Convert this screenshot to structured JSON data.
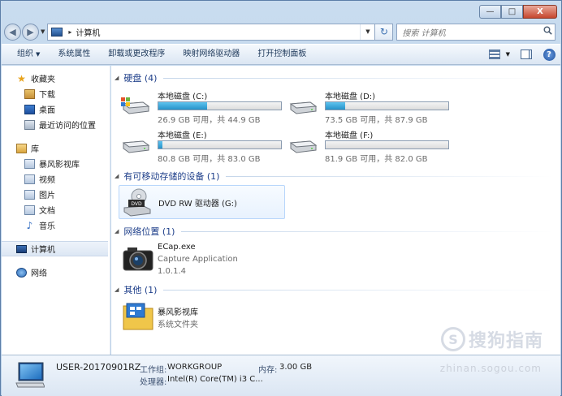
{
  "window": {
    "min": "—",
    "max": "□",
    "close": "X"
  },
  "nav": {
    "back": "◀",
    "forward": "▶",
    "history": "▼",
    "address": "计算机",
    "address_sep": "▸",
    "dropdown": "▼",
    "refresh": "↻"
  },
  "search": {
    "placeholder": "搜索 计算机",
    "icon": "search-icon"
  },
  "toolbar": {
    "organize": "组织",
    "system_properties": "系统属性",
    "uninstall": "卸载或更改程序",
    "map_drive": "映射网络驱动器",
    "control_panel": "打开控制面板",
    "view_arrow": "▼",
    "help": "?"
  },
  "sidebar": {
    "favorites": "收藏夹",
    "downloads": "下载",
    "desktop": "桌面",
    "recent": "最近访问的位置",
    "libraries": "库",
    "storm": "暴风影视库",
    "videos": "视频",
    "pictures": "图片",
    "documents": "文档",
    "music": "音乐",
    "computer": "计算机",
    "network": "网络"
  },
  "sections": {
    "hdd": "硬盘 (4)",
    "removable": "有可移动存储的设备 (1)",
    "network": "网络位置 (1)",
    "other": "其他 (1)"
  },
  "drives": [
    {
      "name": "本地磁盘 (C:)",
      "free": "26.9 GB 可用，共 44.9 GB",
      "used_fraction": 0.4
    },
    {
      "name": "本地磁盘 (D:)",
      "free": "73.5 GB 可用，共 87.9 GB",
      "used_fraction": 0.16
    },
    {
      "name": "本地磁盘 (E:)",
      "free": "80.8 GB 可用，共 83.0 GB",
      "used_fraction": 0.03
    },
    {
      "name": "本地磁盘 (F:)",
      "free": "81.9 GB 可用，共 82.0 GB",
      "used_fraction": 0.0
    }
  ],
  "dvd": {
    "name": "DVD RW 驱动器 (G:)",
    "badge": "DVD"
  },
  "network_app": {
    "name": "ECap.exe",
    "desc": "Capture Application",
    "version": "1.0.1.4"
  },
  "other_item": {
    "name": "暴风影视库",
    "desc": "系统文件夹"
  },
  "details": {
    "computer_name": "USER-20170901RZ",
    "workgroup_label": "工作组:",
    "workgroup_value": "WORKGROUP",
    "memory_label": "内存:",
    "memory_value": "3.00 GB",
    "cpu_label": "处理器:",
    "cpu_value": "Intel(R) Core(TM) i3 C..."
  },
  "watermark": {
    "logo": "S",
    "text": "搜狗指南",
    "url": "zhinan.sogou.com"
  }
}
